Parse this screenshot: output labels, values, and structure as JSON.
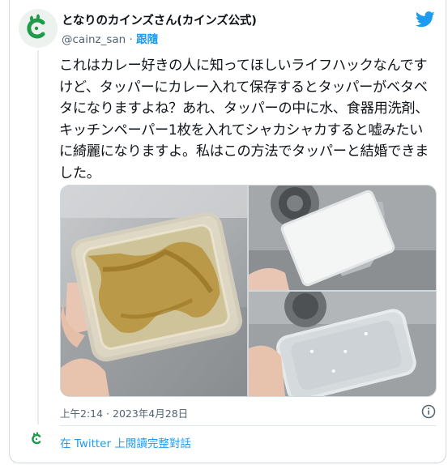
{
  "author": {
    "display_name": "となりのカインズさん(カインズ公式)",
    "handle": "@cainz_san",
    "separator": "·",
    "follow_label": "跟隨"
  },
  "tweet": {
    "text": "これはカレー好きの人に知ってほしいライフハックなんですけど、タッパーにカレー入れて保存するとタッパーがベタベタになりますよね？あれ、タッパーの中に水、食器用洗剤、キッチンペーパー1枚を入れてシャカシャカすると嘘みたいに綺麗になりますよ。私はこの方法でタッパーと結婚できました。",
    "timestamp": "上午2:14 · 2023年4月28日"
  },
  "footer": {
    "read_more_label": "在 Twitter 上閱讀完整對話"
  },
  "colors": {
    "accent": "#1d9bf0",
    "secondary_text": "#536471",
    "brand_green": "#1f9a4a"
  },
  "icons": [
    "cainz-logo-icon",
    "twitter-bird-icon",
    "info-icon"
  ]
}
